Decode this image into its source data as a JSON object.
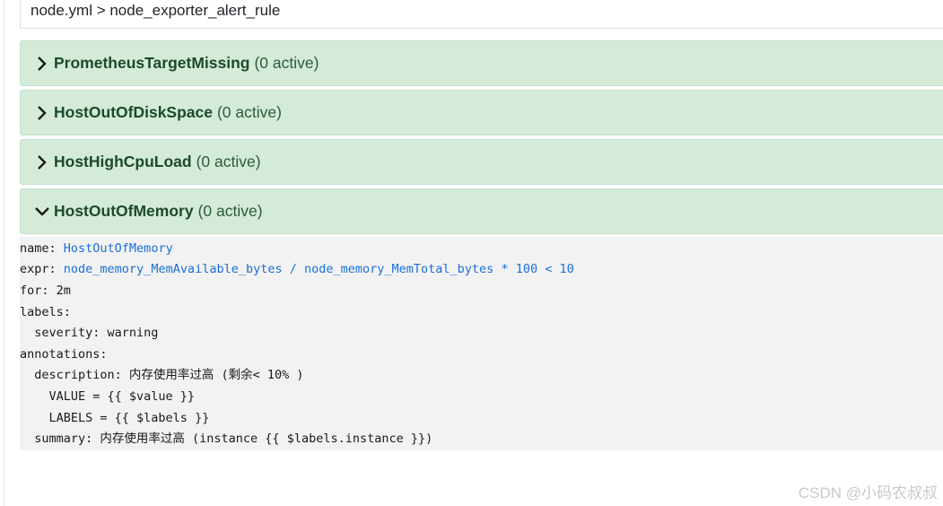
{
  "breadcrumb": "node.yml > node_exporter_alert_rule",
  "rules": [
    {
      "name": "PrometheusTargetMissing",
      "count": "(0 active)",
      "expanded": false
    },
    {
      "name": "HostOutOfDiskSpace",
      "count": "(0 active)",
      "expanded": false
    },
    {
      "name": "HostHighCpuLoad",
      "count": "(0 active)",
      "expanded": false
    },
    {
      "name": "HostOutOfMemory",
      "count": "(0 active)",
      "expanded": true
    }
  ],
  "yaml": {
    "name_key": "name: ",
    "name_val": "HostOutOfMemory",
    "expr_key": "expr: ",
    "expr_val": "node_memory_MemAvailable_bytes / node_memory_MemTotal_bytes * 100 < 10",
    "for_line": "for: 2m",
    "labels_line": "labels:",
    "severity_line": "  severity: warning",
    "annotations_line": "annotations:",
    "description_line": "  description: 内存使用率过高 (剩余< 10% )",
    "value_line": "    VALUE = {{ $value }}",
    "labels_var_line": "    LABELS = {{ $labels }}",
    "summary_line": "  summary: 内存使用率过高 (instance {{ $labels.instance }})"
  },
  "watermark": "CSDN @小码农叔叔",
  "colors": {
    "header_bg": "#d4ebd9",
    "header_text": "#1c4a29",
    "yaml_link": "#1a6fd8",
    "yaml_bg": "#f2f2f2"
  },
  "icons": {
    "collapsed": "chevron-right-icon",
    "expanded": "chevron-down-icon"
  }
}
